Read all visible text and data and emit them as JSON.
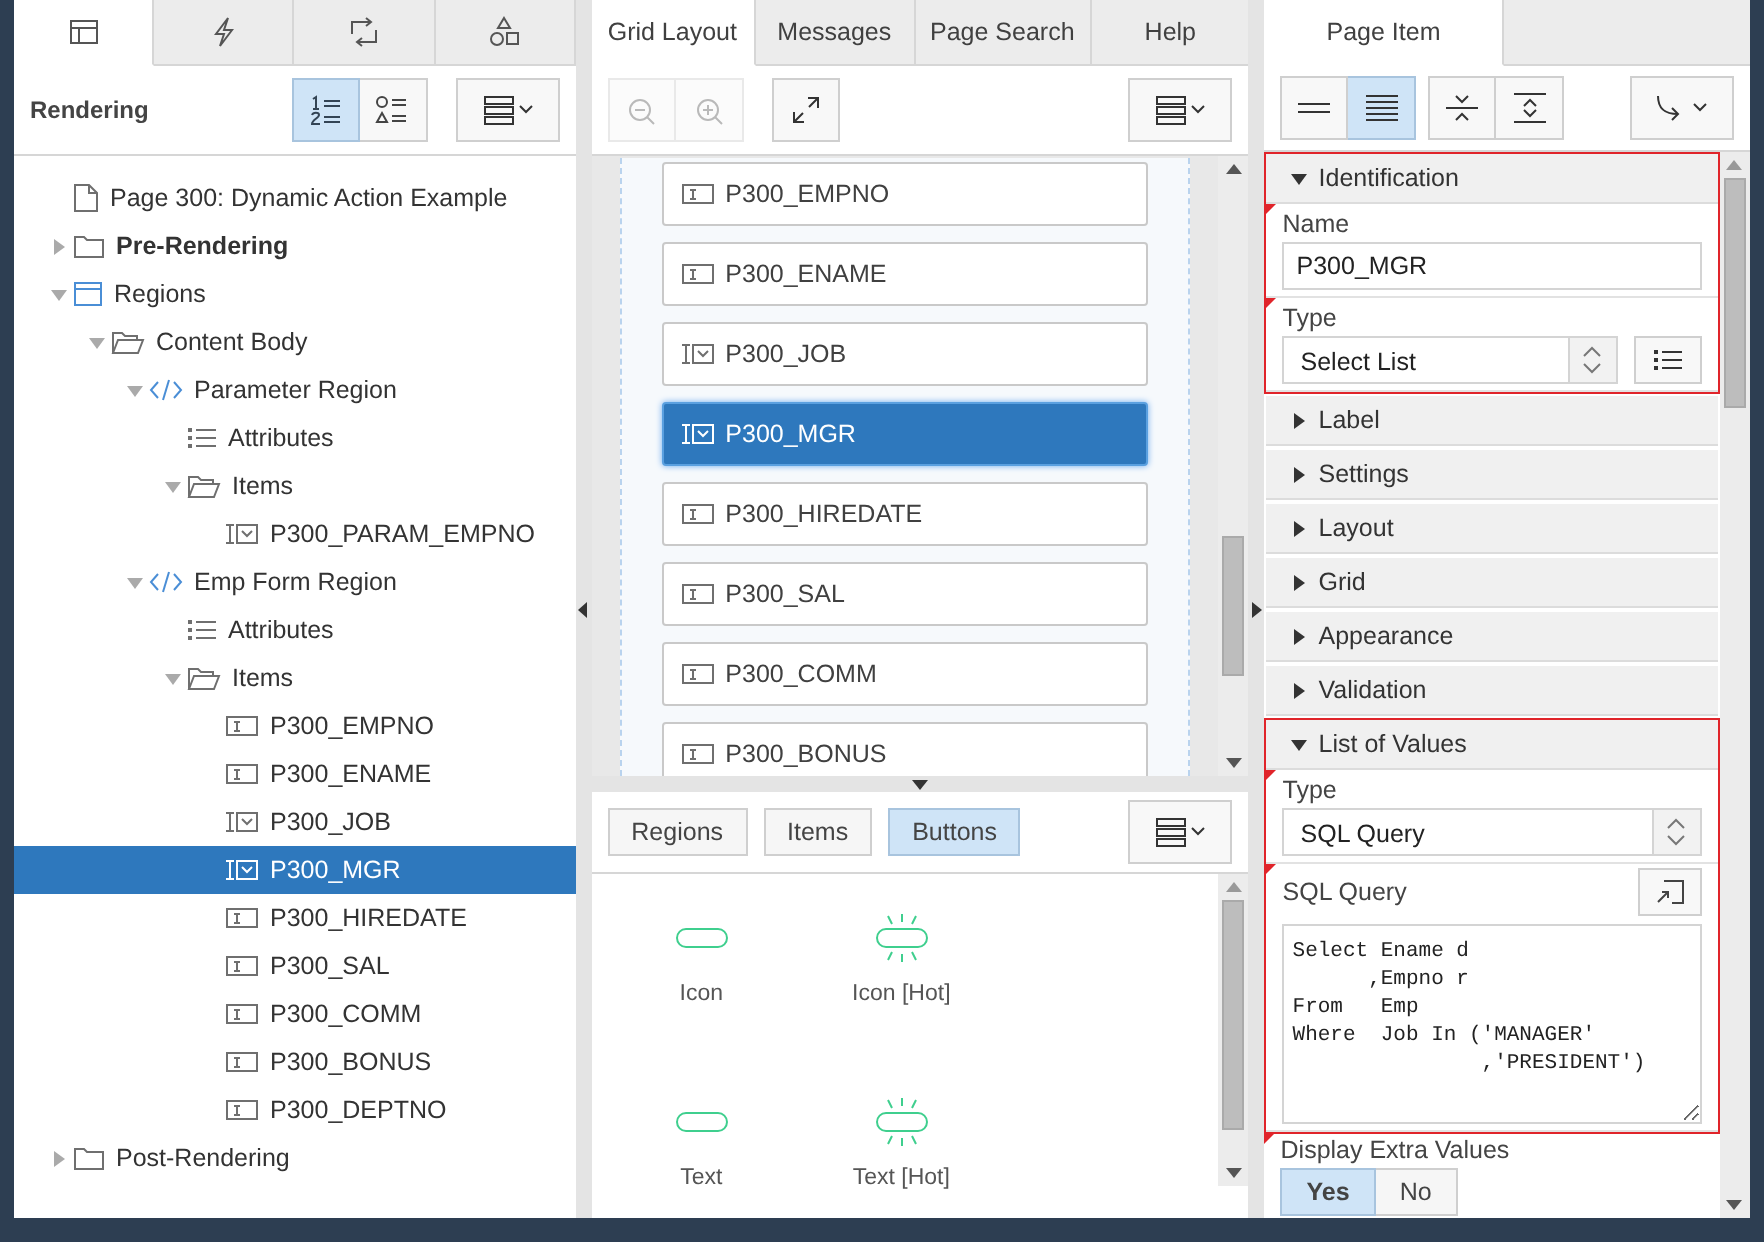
{
  "left_panel": {
    "tabs": [
      {
        "kind": "rendering",
        "selected": true
      },
      {
        "kind": "dynamic-actions",
        "selected": false
      },
      {
        "kind": "processing",
        "selected": false
      },
      {
        "kind": "shared-components",
        "selected": false
      }
    ],
    "title": "Rendering",
    "view_buttons": [
      {
        "kind": "numbered",
        "selected": true
      },
      {
        "kind": "shapes",
        "selected": false
      }
    ],
    "tree": [
      {
        "label": "Page 300: Dynamic Action Example",
        "kind": "page",
        "bold": false,
        "selected": false
      },
      {
        "label": "Pre-Rendering",
        "kind": "folder",
        "bold": true,
        "selected": false,
        "expanded": false
      },
      {
        "label": "Regions",
        "kind": "regions",
        "bold": false,
        "selected": false,
        "expanded": true,
        "children": [
          {
            "label": "Content Body",
            "kind": "folder-open",
            "selected": false,
            "expanded": true,
            "children": [
              {
                "label": "Parameter Region",
                "kind": "region",
                "selected": false,
                "expanded": true,
                "children": [
                  {
                    "label": "Attributes",
                    "kind": "attributes",
                    "selected": false
                  },
                  {
                    "label": "Items",
                    "kind": "folder-open",
                    "selected": false,
                    "expanded": true,
                    "children": [
                      {
                        "label": "P300_PARAM_EMPNO",
                        "kind": "select-item",
                        "selected": false
                      }
                    ]
                  }
                ]
              },
              {
                "label": "Emp Form Region",
                "kind": "region",
                "selected": false,
                "expanded": true,
                "children": [
                  {
                    "label": "Attributes",
                    "kind": "attributes",
                    "selected": false
                  },
                  {
                    "label": "Items",
                    "kind": "folder-open",
                    "selected": false,
                    "expanded": true,
                    "children": [
                      {
                        "label": "P300_EMPNO",
                        "kind": "text-item",
                        "selected": false
                      },
                      {
                        "label": "P300_ENAME",
                        "kind": "text-item",
                        "selected": false
                      },
                      {
                        "label": "P300_JOB",
                        "kind": "select-item",
                        "selected": false
                      },
                      {
                        "label": "P300_MGR",
                        "kind": "select-item",
                        "selected": true
                      },
                      {
                        "label": "P300_HIREDATE",
                        "kind": "text-item",
                        "selected": false
                      },
                      {
                        "label": "P300_SAL",
                        "kind": "text-item",
                        "selected": false
                      },
                      {
                        "label": "P300_COMM",
                        "kind": "text-item",
                        "selected": false
                      },
                      {
                        "label": "P300_BONUS",
                        "kind": "text-item",
                        "selected": false
                      },
                      {
                        "label": "P300_DEPTNO",
                        "kind": "text-item",
                        "selected": false
                      }
                    ]
                  }
                ]
              }
            ]
          }
        ]
      },
      {
        "label": "Post-Rendering",
        "kind": "folder",
        "bold": false,
        "selected": false,
        "expanded": false
      }
    ]
  },
  "middle_panel": {
    "tabs": [
      {
        "label": "Grid Layout",
        "selected": true
      },
      {
        "label": "Messages",
        "selected": false
      },
      {
        "label": "Page Search",
        "selected": false
      },
      {
        "label": "Help",
        "selected": false
      }
    ],
    "zoom_disabled": true,
    "grid_items": [
      {
        "label": "P300_EMPNO",
        "kind": "text-item",
        "selected": false
      },
      {
        "label": "P300_ENAME",
        "kind": "text-item",
        "selected": false
      },
      {
        "label": "P300_JOB",
        "kind": "select-item",
        "selected": false
      },
      {
        "label": "P300_MGR",
        "kind": "select-item",
        "selected": true
      },
      {
        "label": "P300_HIREDATE",
        "kind": "text-item",
        "selected": false
      },
      {
        "label": "P300_SAL",
        "kind": "text-item",
        "selected": false
      },
      {
        "label": "P300_COMM",
        "kind": "text-item",
        "selected": false
      },
      {
        "label": "P300_BONUS",
        "kind": "text-item",
        "selected": false
      }
    ],
    "gallery_tabs": [
      {
        "label": "Regions",
        "selected": false
      },
      {
        "label": "Items",
        "selected": false
      },
      {
        "label": "Buttons",
        "selected": true
      }
    ],
    "gallery_items": [
      {
        "label": "Icon",
        "hot": false
      },
      {
        "label": "Icon [Hot]",
        "hot": true
      },
      {
        "label": "Text",
        "hot": false
      },
      {
        "label": "Text [Hot]",
        "hot": true
      }
    ]
  },
  "right_panel": {
    "tabs": [
      {
        "label": "Page Item",
        "selected": true
      }
    ],
    "view_buttons": [
      {
        "kind": "show-common",
        "selected": false
      },
      {
        "kind": "show-all",
        "selected": true
      },
      {
        "kind": "collapse-all",
        "selected": false
      },
      {
        "kind": "expand-all",
        "selected": false
      }
    ],
    "groups": [
      {
        "title": "Identification",
        "expanded": true,
        "highlighted": true,
        "properties": [
          {
            "label": "Name",
            "kind": "text",
            "value": "P300_MGR",
            "required": true
          },
          {
            "label": "Type",
            "kind": "select",
            "value": "Select List",
            "required": true,
            "list_button": true
          }
        ]
      },
      {
        "title": "Label",
        "expanded": false,
        "highlighted": false
      },
      {
        "title": "Settings",
        "expanded": false,
        "highlighted": false
      },
      {
        "title": "Layout",
        "expanded": false,
        "highlighted": false
      },
      {
        "title": "Grid",
        "expanded": false,
        "highlighted": false
      },
      {
        "title": "Appearance",
        "expanded": false,
        "highlighted": false
      },
      {
        "title": "Validation",
        "expanded": false,
        "highlighted": false
      },
      {
        "title": "List of Values",
        "expanded": true,
        "highlighted": true,
        "properties": [
          {
            "label": "Type",
            "kind": "select",
            "value": "SQL Query",
            "required": true,
            "list_button": false
          },
          {
            "label": "SQL Query",
            "kind": "code",
            "value": "Select Ename d\n      ,Empno r\nFrom   Emp\nWhere  Job In ('MANAGER'\n               ,'PRESIDENT')",
            "required": true
          }
        ]
      }
    ],
    "extra_property": {
      "label": "Display Extra Values",
      "required": true,
      "options": [
        {
          "label": "Yes",
          "selected": true
        },
        {
          "label": "No",
          "selected": false
        }
      ]
    }
  }
}
